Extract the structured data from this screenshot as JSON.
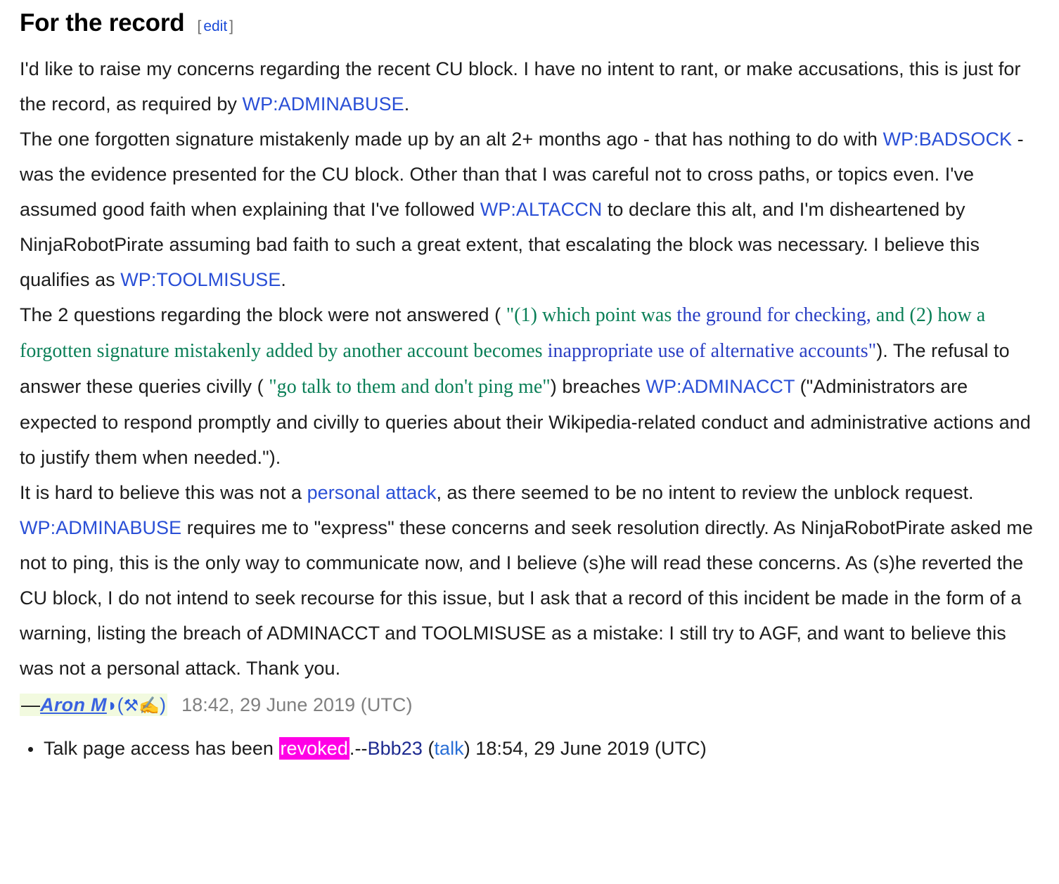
{
  "section": {
    "heading": "For the record",
    "edit_open_bracket": "[",
    "edit_label": "edit",
    "edit_close_bracket": "]"
  },
  "colors": {
    "link_blue": "#2a4fd6",
    "quote_green": "#0a7f57",
    "quote_blue": "#2a3fc4",
    "highlight_magenta": "#ff00e6",
    "signature_highlight": "#f2fadf",
    "timestamp_gray": "#808080",
    "user_dark_blue": "#1d2a8f"
  },
  "paragraphs": {
    "p1": {
      "t1": "I'd like to raise my concerns regarding the recent CU block. I have no intent to rant, or make accusations, this is just for the record, as required by ",
      "link1": "WP:ADMINABUSE",
      "t2": "."
    },
    "p2": {
      "t1": "The one forgotten signature mistakenly made up by an alt 2+ months ago - that has nothing to do with ",
      "link1": "WP:BADSOCK",
      "t2": " - was the evidence presented for the CU block. Other than that I was careful not to cross paths, or topics even. I've assumed good faith when explaining that I've followed ",
      "link2": "WP:ALTACCN",
      "t3": " to declare this alt, and I'm disheartened by NinjaRobotPirate assuming bad faith to such a great extent, that escalating the block was necessary. I believe this qualifies as ",
      "link3": "WP:TOOLMISUSE",
      "t4": "."
    },
    "p3": {
      "t1": "The 2 questions regarding the block were not answered ( ",
      "q1_green_a": "\"(1) which point was ",
      "q1_blue_a": "the ground for checking,",
      "q1_green_b": " and (2) how a forgotten signature mistakenly added by another account becomes ",
      "q1_blue_b": "inappropriate use of alternative accounts\"",
      "t2": "). The refusal to answer these queries civilly ( ",
      "q2_green": "\"go talk to them and don't ping me\"",
      "t3": ") breaches ",
      "link1": "WP:ADMINACCT",
      "t4": " (\"Administrators are expected to respond promptly and civilly to queries about their Wikipedia-related conduct and administrative actions and to justify them when needed.\")."
    },
    "p4": {
      "t1": "It is hard to believe this was not a ",
      "link1": "personal attack",
      "t2": ", as there seemed to be no intent to review the unblock request. ",
      "link2": "WP:ADMINABUSE",
      "t3": " requires me to \"express\" these concerns and seek resolution directly. As NinjaRobotPirate asked me not to ping, this is the only way to communicate now, and I believe (s)he will read these concerns. As (s)he reverted the CU block, I do not intend to seek recourse for this issue, but I ask that a record of this incident be made in the form of a warning, listing the breach of ADMINACCT and TOOLMISUSE as a mistake: I still try to AGF, and want to believe this was not a personal attack. Thank you."
    }
  },
  "signature": {
    "dash": "—",
    "name": "Aron M",
    "leaf_icon": "◗",
    "open_paren": "(",
    "icon_a": "⚒",
    "icon_b": "✍",
    "close_paren": ")",
    "timestamp": "18:42, 29 June 2019 (UTC)"
  },
  "reply": {
    "text_before": "Talk page access has been ",
    "highlighted_word": "revoked",
    "text_after": ".--",
    "user": "Bbb23",
    "paren_open": " (",
    "talk_label": "talk",
    "paren_close": ")",
    "timestamp": " 18:54, 29 June 2019 (UTC)"
  }
}
